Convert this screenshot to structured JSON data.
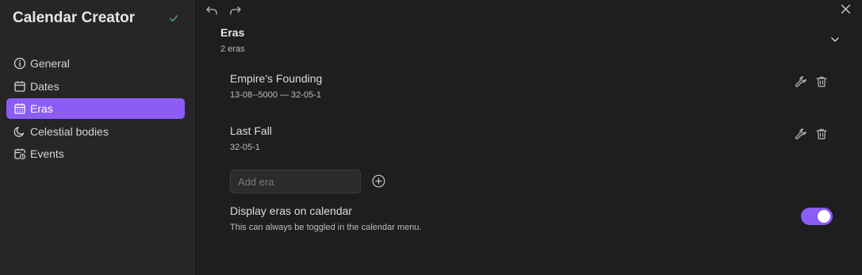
{
  "sidebar": {
    "title": "Calendar Creator",
    "status_icon": "check-icon",
    "accent": "#8b5cf6",
    "items": [
      {
        "label": "General",
        "icon": "info-circle-icon",
        "active": false
      },
      {
        "label": "Dates",
        "icon": "calendar-icon",
        "active": false
      },
      {
        "label": "Eras",
        "icon": "calendar-days-icon",
        "active": true
      },
      {
        "label": "Celestial bodies",
        "icon": "moon-icon",
        "active": false
      },
      {
        "label": "Events",
        "icon": "calendar-clock-icon",
        "active": false
      }
    ]
  },
  "toolbar": {
    "undo_icon": "undo-icon",
    "redo_icon": "redo-icon",
    "close_icon": "close-icon"
  },
  "main": {
    "section_title": "Eras",
    "section_subtitle": "2 eras",
    "eras": [
      {
        "name": "Empire's Founding",
        "dates": "13-08--5000 — 32-05-1"
      },
      {
        "name": "Last Fall",
        "dates": "32-05-1"
      }
    ],
    "add_placeholder": "Add era",
    "add_value": "",
    "setting": {
      "name": "Display eras on calendar",
      "description": "This can always be toggled in the calendar menu.",
      "enabled": true
    }
  }
}
